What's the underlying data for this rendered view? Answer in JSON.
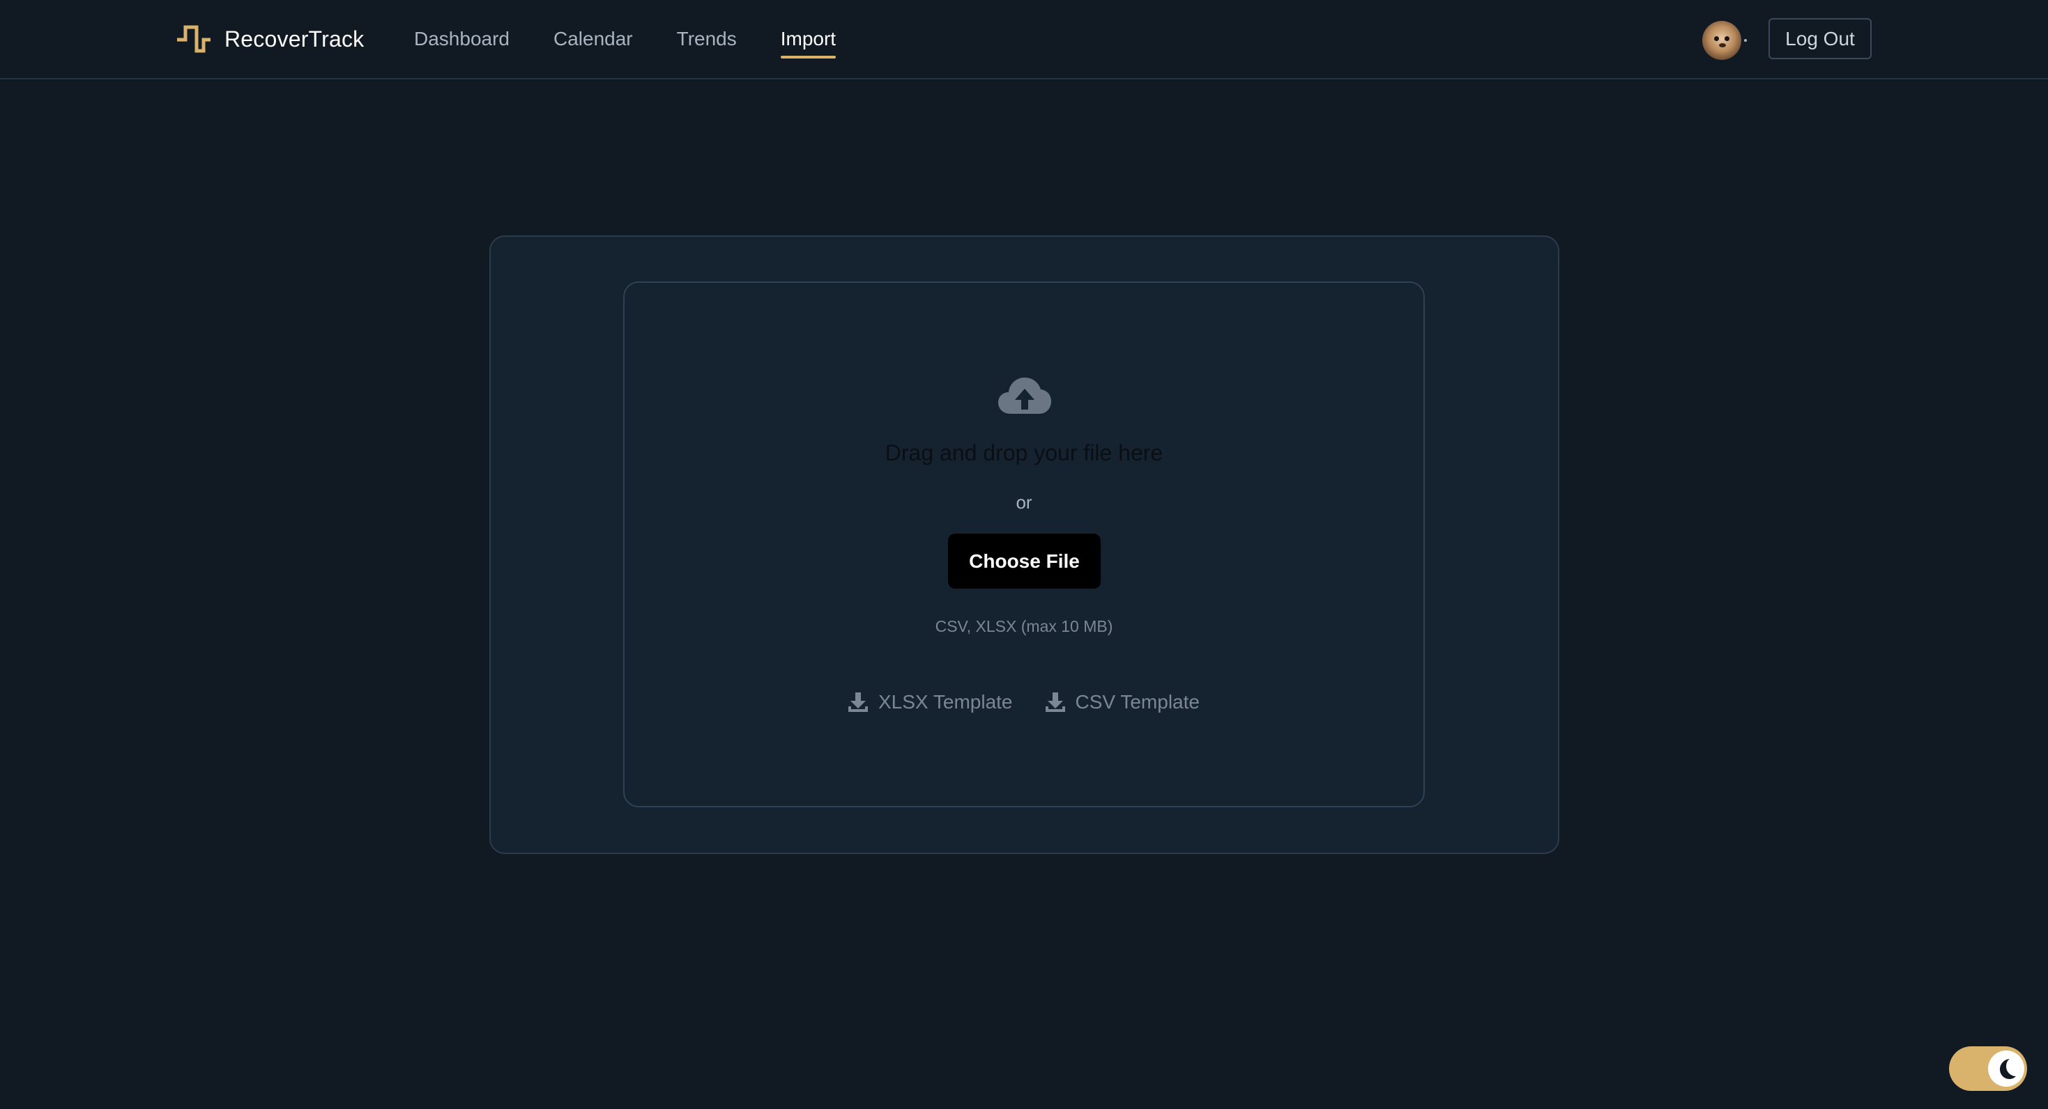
{
  "app": {
    "name": "RecoverTrack",
    "logo_icon": "pulse-step-icon",
    "accent_color": "#d9b36c"
  },
  "nav": {
    "items": [
      {
        "label": "Dashboard",
        "active": false
      },
      {
        "label": "Calendar",
        "active": false
      },
      {
        "label": "Trends",
        "active": false
      },
      {
        "label": "Import",
        "active": true
      }
    ]
  },
  "user": {
    "avatar_icon": "hamster-avatar",
    "logout_label": "Log Out"
  },
  "upload": {
    "icon": "cloud-upload-icon",
    "title": "Drag and drop your file here",
    "or_text": "or",
    "choose_label": "Choose File",
    "hint": "CSV, XLSX (max 10 MB)",
    "templates": [
      {
        "label": "XLSX Template",
        "icon": "download-icon"
      },
      {
        "label": "CSV Template",
        "icon": "download-icon"
      }
    ]
  },
  "theme": {
    "mode": "dark",
    "icon": "moon-icon"
  }
}
